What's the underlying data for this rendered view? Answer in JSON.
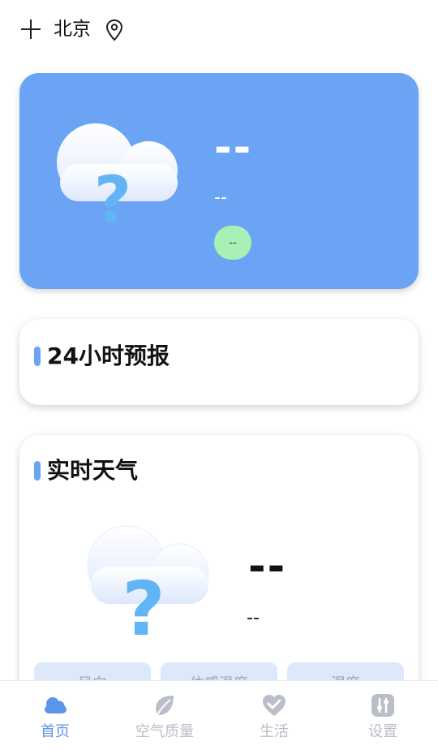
{
  "header": {
    "city": "北京",
    "add_icon": "plus-icon",
    "location_icon": "map-pin-icon"
  },
  "hero": {
    "temperature": "--",
    "description": "--",
    "aqi": "--",
    "icon": "cloud-question-icon",
    "background_color": "#6ba3f5",
    "aqi_color": "#a8f0b5"
  },
  "forecast": {
    "title": "24小时预报"
  },
  "realtime": {
    "title": "实时天气",
    "temperature": "--",
    "description": "--",
    "icon": "cloud-question-icon",
    "details": [
      "风向",
      "体感温度",
      "湿度"
    ]
  },
  "nav": {
    "items": [
      {
        "label": "首页",
        "icon": "cloud-icon",
        "active": true
      },
      {
        "label": "空气质量",
        "icon": "leaf-icon",
        "active": false
      },
      {
        "label": "生活",
        "icon": "heart-check-icon",
        "active": false
      },
      {
        "label": "设置",
        "icon": "sliders-icon",
        "active": false
      }
    ],
    "active_color": "#5b95ea",
    "inactive_color": "#b9bec8"
  }
}
